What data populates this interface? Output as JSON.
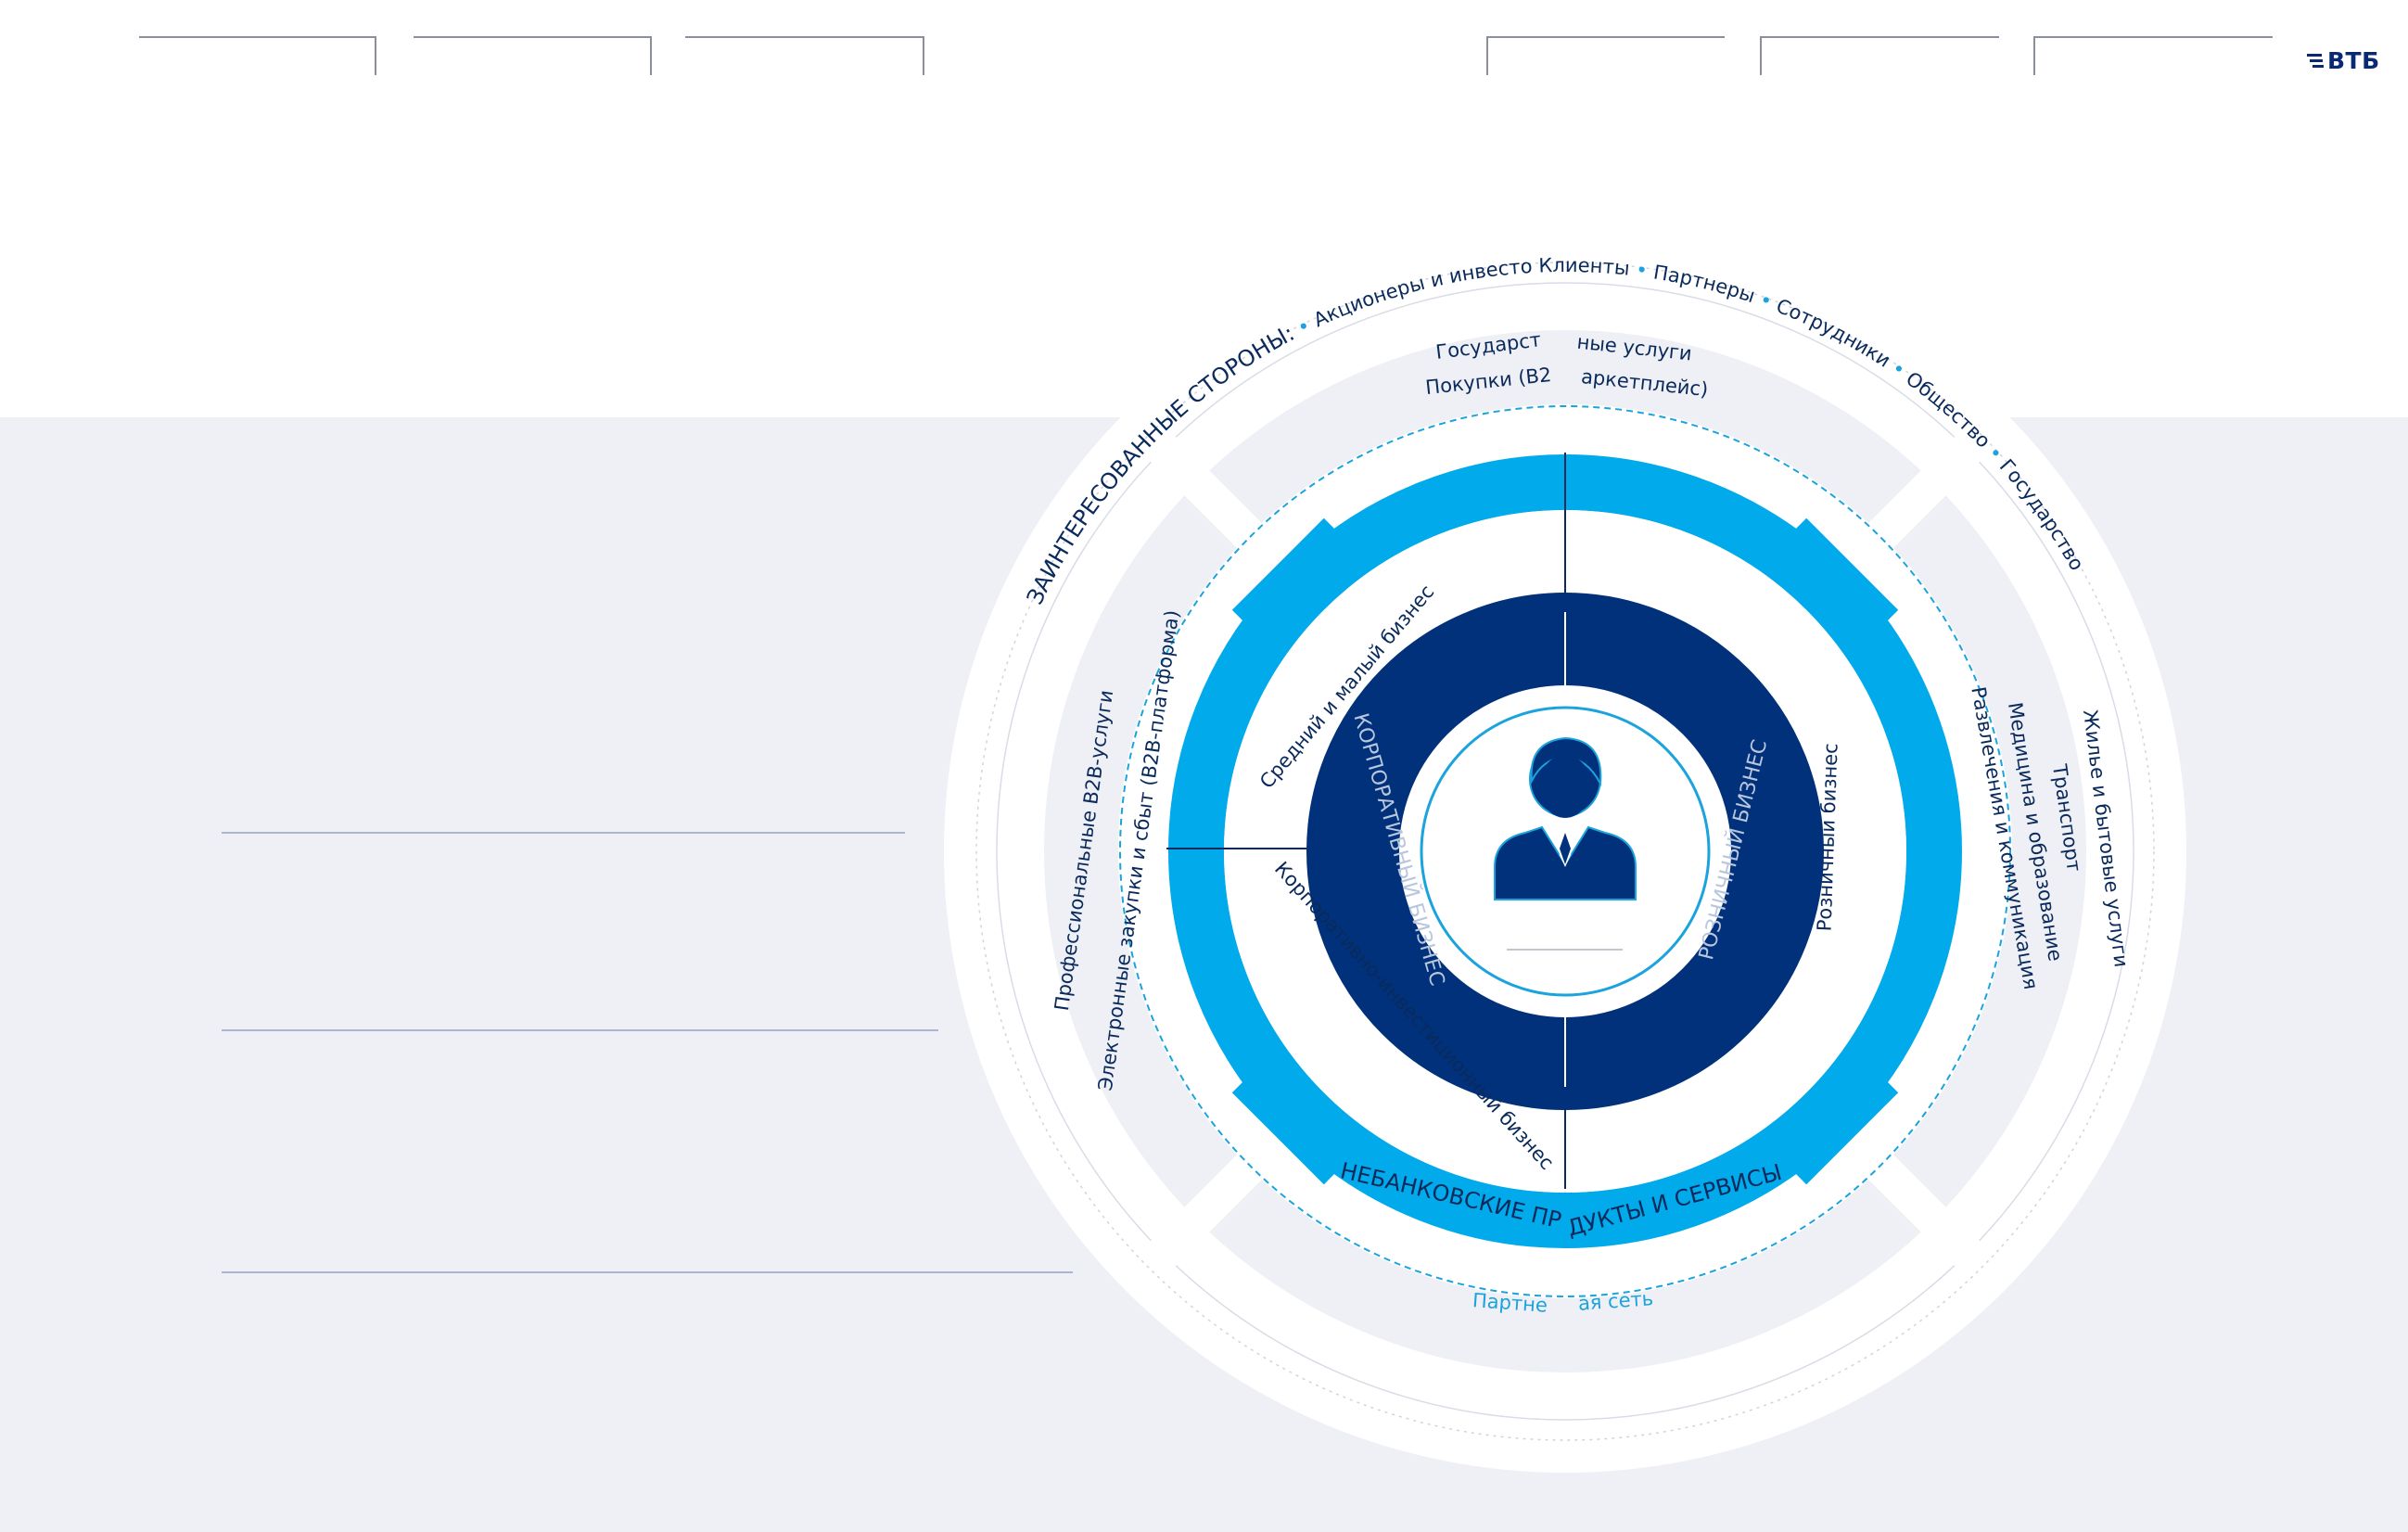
{
  "brand": {
    "logo_text": "ВТБ",
    "colors": {
      "navy": "#00317a",
      "blue": "#00aaeb",
      "dark_text": "#0a2a5c",
      "panel": "#eff0f5"
    }
  },
  "stakeholders": {
    "heading": "ЗАИНТЕРЕСОВАННЫЕ СТОРОНЫ:",
    "items": [
      "Акционеры и инвесто",
      "Клиенты",
      "Партнеры",
      "Сотрудники",
      "Общество",
      "Государство"
    ]
  },
  "top_sector": {
    "line1a": "Государст",
    "line1b": "ные услуги",
    "line2a": "Покупки (B2",
    "line2b": "аркетплейс)"
  },
  "left_sector": {
    "line1": "Профессиональные B2B-услуги",
    "line2": "Электронные закупки и сбыт (B2B-платформа)"
  },
  "right_sector": {
    "line1": "Жилье и бытовые услуги",
    "line2": "Транспорт",
    "line3": "Медицина и образование",
    "line4": "Развлечения и коммуникация"
  },
  "non_bank": {
    "part_a": "НЕБАНКОВСКИЕ ПР",
    "part_b": "ДУКТЫ И СЕРВИСЫ"
  },
  "partner_network": {
    "part_a": "Партне",
    "part_b": "ая сеть"
  },
  "business_lines": {
    "sme": "Средний и малый бизнес",
    "cib": "Корпоративно-инвестиционный бизнес",
    "retail_outer": "Розничный бизнес",
    "corporate_inner": "КОРПОРАТИВНЫЙ БИЗНЕС",
    "retail_inner": "РОЗНИЧНЫЙ БИЗНЕС"
  },
  "center": {
    "icon": "person-icon"
  }
}
